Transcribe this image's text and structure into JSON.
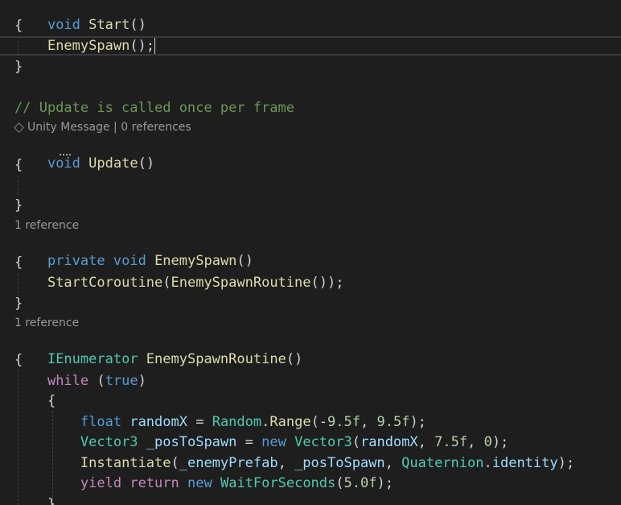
{
  "code": {
    "start_decl": {
      "kw": "void",
      "name": "Start",
      "paren": "()"
    },
    "brace_open_1": "{",
    "enemy_spawn_call": {
      "name": "EnemySpawn",
      "rest": "();"
    },
    "brace_close_1": "}",
    "comment": "// Update is called once per frame",
    "update_lens": "Unity Message | 0 references",
    "update_decl": {
      "kw": "void",
      "name": "Update",
      "paren": "()"
    },
    "brace_open_2": "{",
    "brace_close_2": "}",
    "enemyspawn_lens": "1 reference",
    "enemyspawn_decl": {
      "kw1": "private",
      "kw2": "void",
      "name": "EnemySpawn",
      "paren": "()"
    },
    "brace_open_3": "{",
    "start_coroutine_call": {
      "name1": "StartCoroutine",
      "p1": "(",
      "name2": "EnemySpawnRoutine",
      "p2": "());"
    },
    "brace_close_3": "}",
    "routine_lens": "1 reference",
    "routine_decl": {
      "type": "IEnumerator",
      "name": "EnemySpawnRoutine",
      "paren": "()"
    },
    "brace_open_4": "{",
    "while_line": {
      "kw": "while",
      "p1": " (",
      "val": "true",
      "p2": ")"
    },
    "brace_open_5": "{",
    "float_line": {
      "kw": "float",
      "var": "randomX",
      "eq": " = ",
      "type": "Random",
      "dot": ".",
      "method": "Range",
      "p1": "(-",
      "n1": "9.5f",
      "p2": ", ",
      "n2": "9.5f",
      "p3": ");"
    },
    "vector_line": {
      "type": "Vector3",
      "var": "_posToSpawn",
      "eq": " = ",
      "kw": "new",
      "type2": "Vector3",
      "p1": "(",
      "arg1": "randomX",
      "p2": ", ",
      "n1": "7.5f",
      "p3": ", ",
      "n2": "0",
      "p4": ");"
    },
    "instantiate_line": {
      "method": "Instantiate",
      "p1": "(",
      "arg1": "_enemyPrefab",
      "p2": ", ",
      "arg2": "_posToSpawn",
      "p3": ", ",
      "type": "Quaternion",
      "dot": ".",
      "prop": "identity",
      "p4": ");"
    },
    "yield_line": {
      "kw1": "yield",
      "kw2": "return",
      "kw3": "new",
      "type": "WaitForSeconds",
      "p1": "(",
      "n1": "5.0f",
      "p2": ");"
    },
    "brace_close_5": "}"
  },
  "colors": {
    "background": "#1e1e1e",
    "keyword": "#569cd6",
    "control_keyword": "#c586c0",
    "method": "#dcdcaa",
    "type": "#4ec9b0",
    "variable": "#9cdcfe",
    "number": "#b5cea8",
    "comment": "#6a9955",
    "codelens": "#999999"
  },
  "icons": {
    "unity_message": "cube-icon"
  }
}
